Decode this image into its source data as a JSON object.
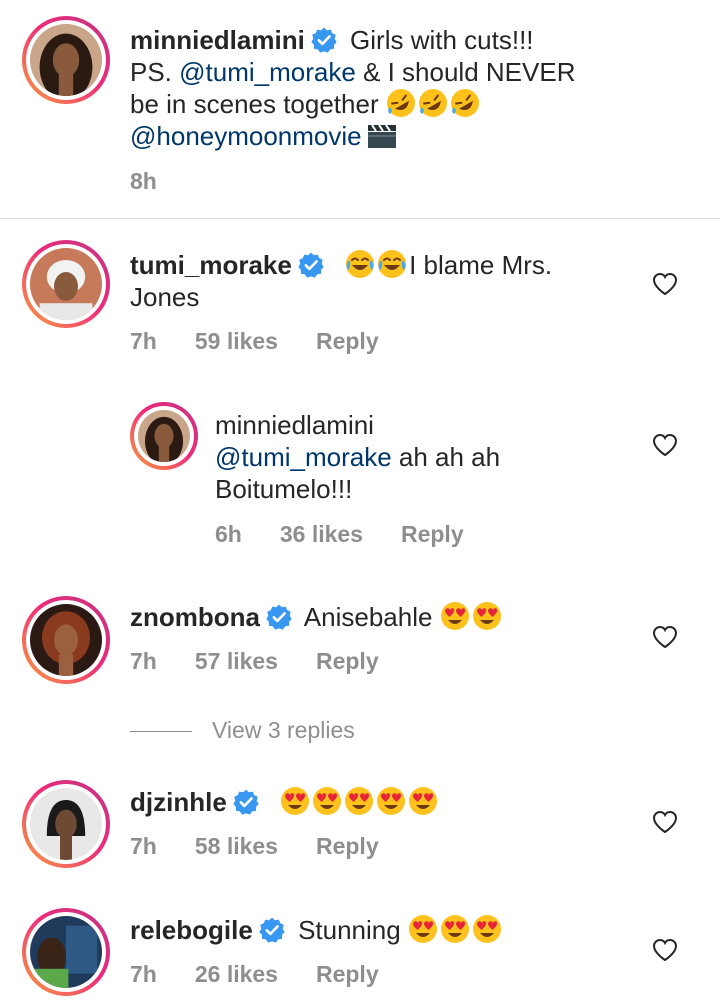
{
  "caption": {
    "username": "minniedlamini",
    "line1": "Girls with cuts!!!",
    "line2_prefix": "PS. ",
    "mention1": "@tumi_morake",
    "line2_suffix": " & I should NEVER",
    "line3": "be in scenes together",
    "mention2": "@honeymoonmovie",
    "time": "8h"
  },
  "comments": [
    {
      "username": "tumi_morake",
      "text_a": "I blame Mrs.",
      "text_b": "Jones",
      "time": "7h",
      "likes": "59 likes",
      "reply": "Reply"
    },
    {
      "username": "minniedlamini",
      "mention": "@tumi_morake",
      "text_a": " ah ah ah",
      "text_b": "Boitumelo!!!",
      "time": "6h",
      "likes": "36 likes",
      "reply": "Reply"
    },
    {
      "username": "znombona",
      "text": "Anisebahle",
      "time": "7h",
      "likes": "57 likes",
      "reply": "Reply"
    },
    {
      "username": "djzinhle",
      "time": "7h",
      "likes": "58 likes",
      "reply": "Reply"
    },
    {
      "username": "relebogile",
      "text": "Stunning",
      "time": "7h",
      "likes": "26 likes",
      "reply": "Reply"
    }
  ],
  "view_replies": "View 3 replies",
  "colors": {
    "text": "#262626",
    "muted": "#8e8e8e",
    "mention": "#00376b",
    "verified": "#3897f0"
  },
  "icons": [
    "verified-badge-icon",
    "heart-icon",
    "rofl-emoji",
    "joy-emoji",
    "heart-eyes-emoji",
    "clapper-board-emoji"
  ]
}
